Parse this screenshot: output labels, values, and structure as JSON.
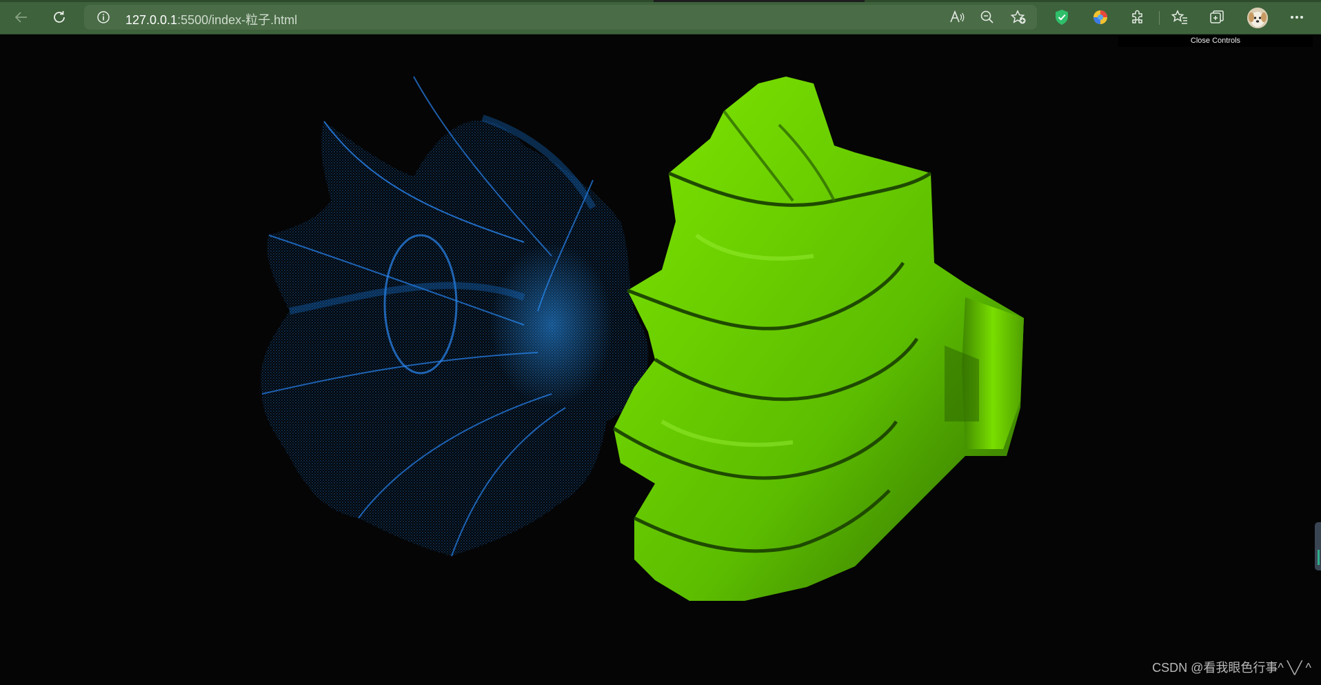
{
  "browser": {
    "url_host": "127.0.0.1",
    "url_rest": ":5500/index-粒子.html",
    "icons": {
      "back": "back-arrow-icon",
      "refresh": "refresh-icon",
      "info": "info-icon",
      "read_aloud": "read-aloud-icon",
      "zoom": "zoom-out-icon",
      "favorite_add": "add-favorite-icon",
      "shield": "shield-icon",
      "extension_color": "color-extension-icon",
      "extensions": "puzzle-icon",
      "favorites": "favorites-icon",
      "collections": "collections-icon",
      "profile": "avatar",
      "more": "more-icon"
    },
    "accent": "#3e623c"
  },
  "gui": {
    "close_controls_label": "Close Controls"
  },
  "scene": {
    "particle_color": "#1e7fe6",
    "solid_color": "#6fd400",
    "background": "#050505"
  },
  "watermark": {
    "text": "CSDN @看我眼色行事^ ╲╱ ^"
  }
}
